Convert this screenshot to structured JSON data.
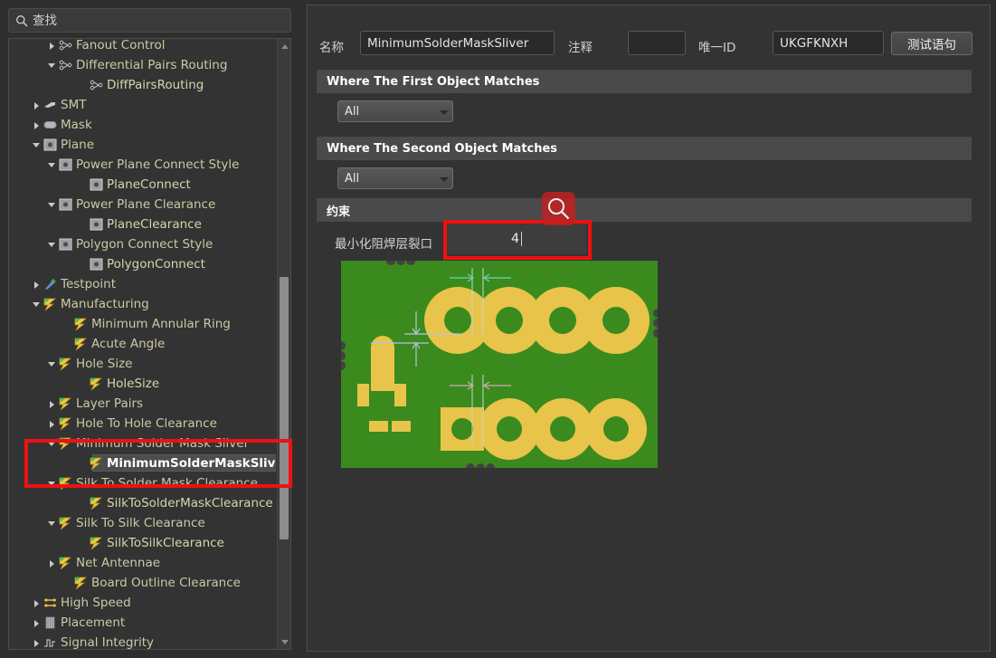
{
  "search": {
    "placeholder": "查找",
    "icon": "search-icon"
  },
  "tree": {
    "items": [
      {
        "label": "Fanout Control",
        "indent": 2,
        "state": "closed",
        "icon": "fanout-icon",
        "type": "rule"
      },
      {
        "label": "Differential Pairs Routing",
        "indent": 2,
        "state": "open",
        "icon": "fanout-icon",
        "type": "rule"
      },
      {
        "label": "DiffPairsRouting",
        "indent": 4,
        "state": "none",
        "icon": "fanout-icon",
        "type": "leaf"
      },
      {
        "label": "SMT",
        "indent": 1,
        "state": "closed",
        "icon": "smt-icon",
        "type": "rule"
      },
      {
        "label": "Mask",
        "indent": 1,
        "state": "closed",
        "icon": "mask-icon",
        "type": "rule"
      },
      {
        "label": "Plane",
        "indent": 1,
        "state": "open",
        "icon": "plane-icon",
        "type": "rule"
      },
      {
        "label": "Power Plane Connect Style",
        "indent": 2,
        "state": "open",
        "icon": "plane-icon",
        "type": "rule"
      },
      {
        "label": "PlaneConnect",
        "indent": 4,
        "state": "none",
        "icon": "plane-icon",
        "type": "leaf"
      },
      {
        "label": "Power Plane Clearance",
        "indent": 2,
        "state": "open",
        "icon": "plane-icon",
        "type": "rule"
      },
      {
        "label": "PlaneClearance",
        "indent": 4,
        "state": "none",
        "icon": "plane-icon",
        "type": "leaf"
      },
      {
        "label": "Polygon Connect Style",
        "indent": 2,
        "state": "open",
        "icon": "plane-icon",
        "type": "rule"
      },
      {
        "label": "PolygonConnect",
        "indent": 4,
        "state": "none",
        "icon": "plane-icon",
        "type": "leaf"
      },
      {
        "label": "Testpoint",
        "indent": 1,
        "state": "closed",
        "icon": "testpoint-icon",
        "type": "rule"
      },
      {
        "label": "Manufacturing",
        "indent": 1,
        "state": "open",
        "icon": "manufacturing-icon",
        "type": "rule"
      },
      {
        "label": "Minimum Annular Ring",
        "indent": 3,
        "state": "none",
        "icon": "manufacturing-icon",
        "type": "rule"
      },
      {
        "label": "Acute Angle",
        "indent": 3,
        "state": "none",
        "icon": "manufacturing-icon",
        "type": "rule"
      },
      {
        "label": "Hole Size",
        "indent": 2,
        "state": "open",
        "icon": "manufacturing-icon",
        "type": "rule"
      },
      {
        "label": "HoleSize",
        "indent": 4,
        "state": "none",
        "icon": "manufacturing-icon",
        "type": "leaf"
      },
      {
        "label": "Layer Pairs",
        "indent": 2,
        "state": "closed",
        "icon": "manufacturing-icon",
        "type": "rule"
      },
      {
        "label": "Hole To Hole Clearance",
        "indent": 2,
        "state": "closed",
        "icon": "manufacturing-icon",
        "type": "rule"
      },
      {
        "label": "Minimum Solder Mask Sliver",
        "indent": 2,
        "state": "open",
        "icon": "manufacturing-icon",
        "type": "rule"
      },
      {
        "label": "MinimumSolderMaskSliver",
        "sup": "*",
        "indent": 4,
        "state": "none",
        "icon": "manufacturing-icon",
        "type": "leaf",
        "selected": true
      },
      {
        "label": "Silk To Solder Mask Clearance",
        "indent": 2,
        "state": "open",
        "icon": "manufacturing-icon",
        "type": "rule"
      },
      {
        "label": "SilkToSolderMaskClearance",
        "indent": 4,
        "state": "none",
        "icon": "manufacturing-icon",
        "type": "leaf"
      },
      {
        "label": "Silk To Silk Clearance",
        "indent": 2,
        "state": "open",
        "icon": "manufacturing-icon",
        "type": "rule"
      },
      {
        "label": "SilkToSilkClearance",
        "indent": 4,
        "state": "none",
        "icon": "manufacturing-icon",
        "type": "leaf"
      },
      {
        "label": "Net Antennae",
        "indent": 2,
        "state": "closed",
        "icon": "manufacturing-icon",
        "type": "rule"
      },
      {
        "label": "Board Outline Clearance",
        "indent": 3,
        "state": "none",
        "icon": "manufacturing-icon",
        "type": "rule"
      },
      {
        "label": "High Speed",
        "indent": 1,
        "state": "closed",
        "icon": "highspeed-icon",
        "type": "rule"
      },
      {
        "label": "Placement",
        "indent": 1,
        "state": "closed",
        "icon": "placement-icon",
        "type": "rule"
      },
      {
        "label": "Signal Integrity",
        "indent": 1,
        "state": "closed",
        "icon": "signal-icon",
        "type": "rule"
      }
    ]
  },
  "header": {
    "name_label": "名称",
    "name_value": "MinimumSolderMaskSliver",
    "comment_label": "注释",
    "comment_value": "",
    "uid_label": "唯一ID",
    "uid_value": "UKGFKNXH",
    "test_button": "测试语句"
  },
  "sections": {
    "first_object": "Where The First Object Matches",
    "second_object": "Where The Second Object Matches",
    "constraints": "约束"
  },
  "filters": {
    "first_scope": "All",
    "second_scope": "All",
    "options": [
      "All"
    ]
  },
  "constraint": {
    "label": "最小化阻焊层裂口",
    "value": "4"
  },
  "annotation": {
    "magnifier_icon": "search-icon",
    "highlight_color": "#ee1111"
  },
  "colors": {
    "pcb_substrate": "#3b8a1e",
    "pcb_pad": "#e8c44a",
    "panel_bg": "#333333",
    "section_bar": "#4a4a4a",
    "tree_text": "#cdc9a5"
  }
}
